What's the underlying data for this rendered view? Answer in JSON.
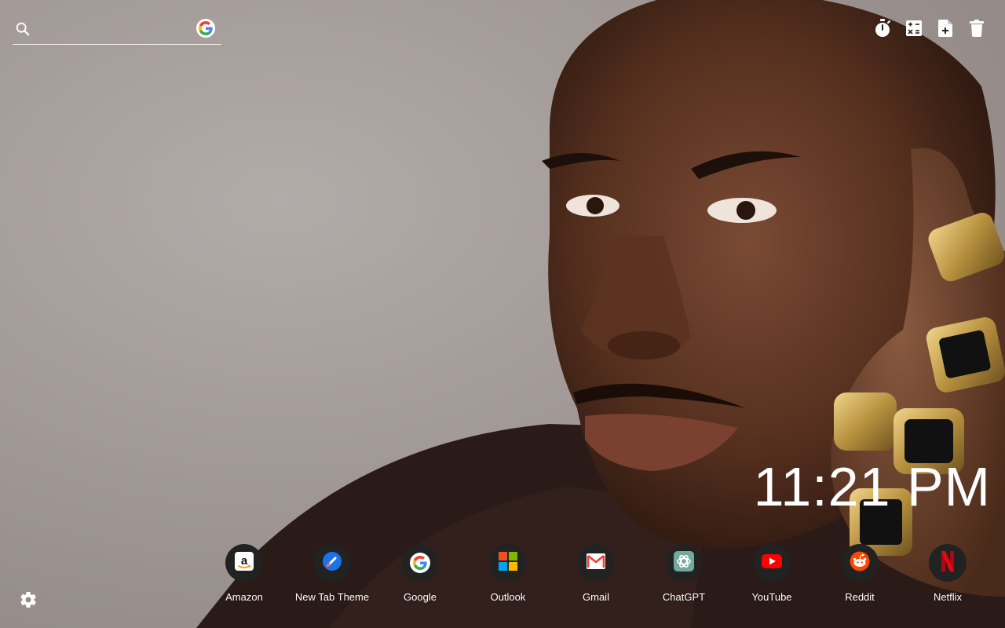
{
  "search": {
    "placeholder": "",
    "engine_icon": "google-icon"
  },
  "tools": [
    {
      "name": "timer-button",
      "icon": "stopwatch-icon"
    },
    {
      "name": "calculator-button",
      "icon": "calculator-icon"
    },
    {
      "name": "add-note-button",
      "icon": "add-file-icon"
    },
    {
      "name": "delete-button",
      "icon": "trash-icon"
    }
  ],
  "clock": {
    "time": "11:21 PM"
  },
  "shortcuts": [
    {
      "label": "Amazon",
      "icon": "amazon-icon"
    },
    {
      "label": "New Tab Theme",
      "icon": "new-tab-theme-icon"
    },
    {
      "label": "Google",
      "icon": "google-icon"
    },
    {
      "label": "Outlook",
      "icon": "microsoft-icon"
    },
    {
      "label": "Gmail",
      "icon": "gmail-icon"
    },
    {
      "label": "ChatGPT",
      "icon": "chatgpt-icon"
    },
    {
      "label": "YouTube",
      "icon": "youtube-icon"
    },
    {
      "label": "Reddit",
      "icon": "reddit-icon"
    },
    {
      "label": "Netflix",
      "icon": "netflix-icon"
    }
  ],
  "settings": {
    "icon": "gear-icon"
  },
  "colors": {
    "background": "#a79f9c",
    "tile": "#222222",
    "text": "#ffffff",
    "google_blue": "#4285F4",
    "google_red": "#EA4335",
    "google_yellow": "#FBBC05",
    "google_green": "#34A853",
    "youtube_red": "#FF0000",
    "netflix_red": "#E50914",
    "reddit_orange": "#FF4500",
    "chatgpt_teal": "#74AA9C"
  }
}
